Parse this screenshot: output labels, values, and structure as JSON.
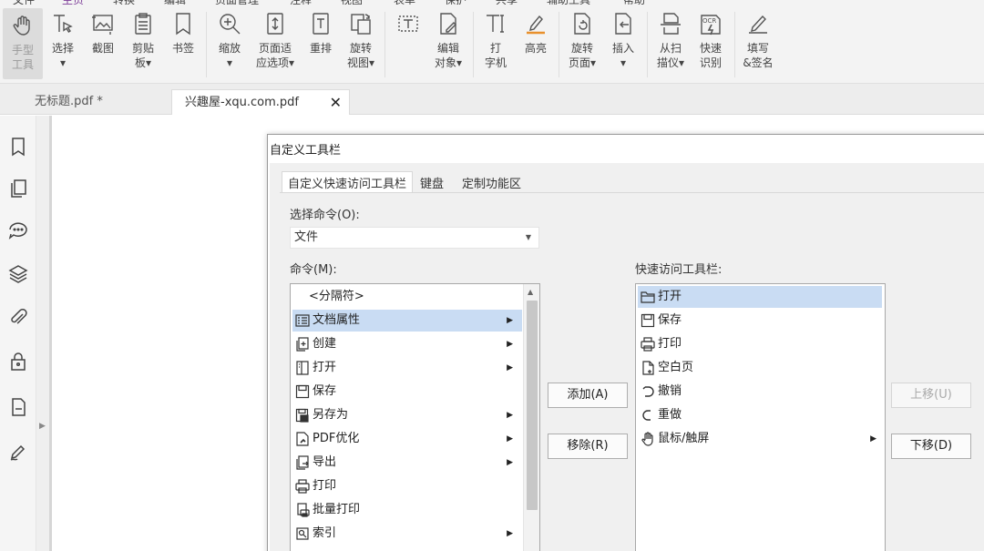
{
  "menu": {
    "items": [
      "文件",
      "主页",
      "转换",
      "编辑",
      "页面管理",
      "注释",
      "视图",
      "表单",
      "保护",
      "共享",
      "辅助工具",
      "帮助"
    ],
    "active": "主页"
  },
  "ribbon": {
    "hand": "手型\n工具",
    "select": "选择\n▾",
    "snapshot": "截图",
    "clipboard": "剪贴\n板▾",
    "bookmark": "书签",
    "zoom": "缩放\n▾",
    "fit_page": "页面适\n应选项▾",
    "reflow": "重排",
    "rotate_view": "旋转\n视图▾",
    "edit_object": "编辑\n对象▾",
    "typewriter": "打\n字机",
    "highlight": "高亮",
    "rotate_page": "旋转\n页面▾",
    "insert": "插入\n▾",
    "scan": "从扫\n描仪▾",
    "ocr": "快速\n识别",
    "fill_sign": "填写\n&签名",
    "ocr_badge": "OCR"
  },
  "tabs": [
    {
      "label": "无标题.pdf *"
    },
    {
      "label": "兴趣屋-xqu.com.pdf",
      "close": "✕"
    }
  ],
  "dialog": {
    "title": "自定义工具栏",
    "tabs": [
      "自定义快速访问工具栏",
      "键盘",
      "定制功能区"
    ],
    "select_cmd_label": "选择命令(O):",
    "select_cmd_value": "文件",
    "commands_label": "命令(M):",
    "quick_label": "快速访问工具栏:",
    "commands": [
      {
        "label": "<分隔符>",
        "icon": "",
        "sub": false
      },
      {
        "label": "文档属性",
        "icon": "doc-properties-icon",
        "sub": true
      },
      {
        "label": "创建",
        "icon": "create-icon",
        "sub": true
      },
      {
        "label": "打开",
        "icon": "open-book-icon",
        "sub": true
      },
      {
        "label": "保存",
        "icon": "save-icon",
        "sub": false
      },
      {
        "label": "另存为",
        "icon": "save-as-icon",
        "sub": true
      },
      {
        "label": "PDF优化",
        "icon": "pdf-optimize-icon",
        "sub": true
      },
      {
        "label": "导出",
        "icon": "export-icon",
        "sub": true
      },
      {
        "label": "打印",
        "icon": "print-icon",
        "sub": false
      },
      {
        "label": "批量打印",
        "icon": "batch-print-icon",
        "sub": false
      },
      {
        "label": "索引",
        "icon": "index-icon",
        "sub": true
      }
    ],
    "quick_items": [
      {
        "label": "打开",
        "icon": "folder-icon",
        "sub": false
      },
      {
        "label": "保存",
        "icon": "save-icon",
        "sub": false
      },
      {
        "label": "打印",
        "icon": "print-icon",
        "sub": false
      },
      {
        "label": "空白页",
        "icon": "blank-page-icon",
        "sub": false
      },
      {
        "label": "撤销",
        "icon": "undo-icon",
        "sub": false
      },
      {
        "label": "重做",
        "icon": "redo-icon",
        "sub": false
      },
      {
        "label": "鼠标/触屏",
        "icon": "hand-touch-icon",
        "sub": true
      }
    ],
    "add_btn": "添加(A)",
    "remove_btn": "移除(R)",
    "up_btn": "上移(U)",
    "down_btn": "下移(D)",
    "chevron": "▶",
    "dropdown": "▼",
    "scroll_up": "▲"
  },
  "colors": {
    "accent": "#7d3c98",
    "highlight": "#c9dcf3"
  }
}
